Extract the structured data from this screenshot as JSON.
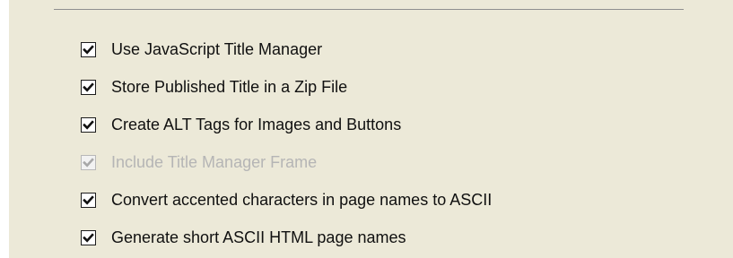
{
  "options": [
    {
      "label": "Use JavaScript Title Manager",
      "checked": true,
      "enabled": true
    },
    {
      "label": "Store Published Title in a Zip File",
      "checked": true,
      "enabled": true
    },
    {
      "label": "Create ALT Tags for Images and Buttons",
      "checked": true,
      "enabled": true
    },
    {
      "label": "Include Title Manager Frame",
      "checked": true,
      "enabled": false
    },
    {
      "label": "Convert accented characters in page names to ASCII",
      "checked": false,
      "enabled": true
    },
    {
      "label": "Generate short ASCII HTML page names",
      "checked": false,
      "enabled": true
    }
  ],
  "colors": {
    "panel_background": "#ece9d8",
    "checkbox_border": "#1c1c1c",
    "disabled_text": "#b5b5b5"
  },
  "icons": {
    "checkmark": "checkmark-icon"
  }
}
